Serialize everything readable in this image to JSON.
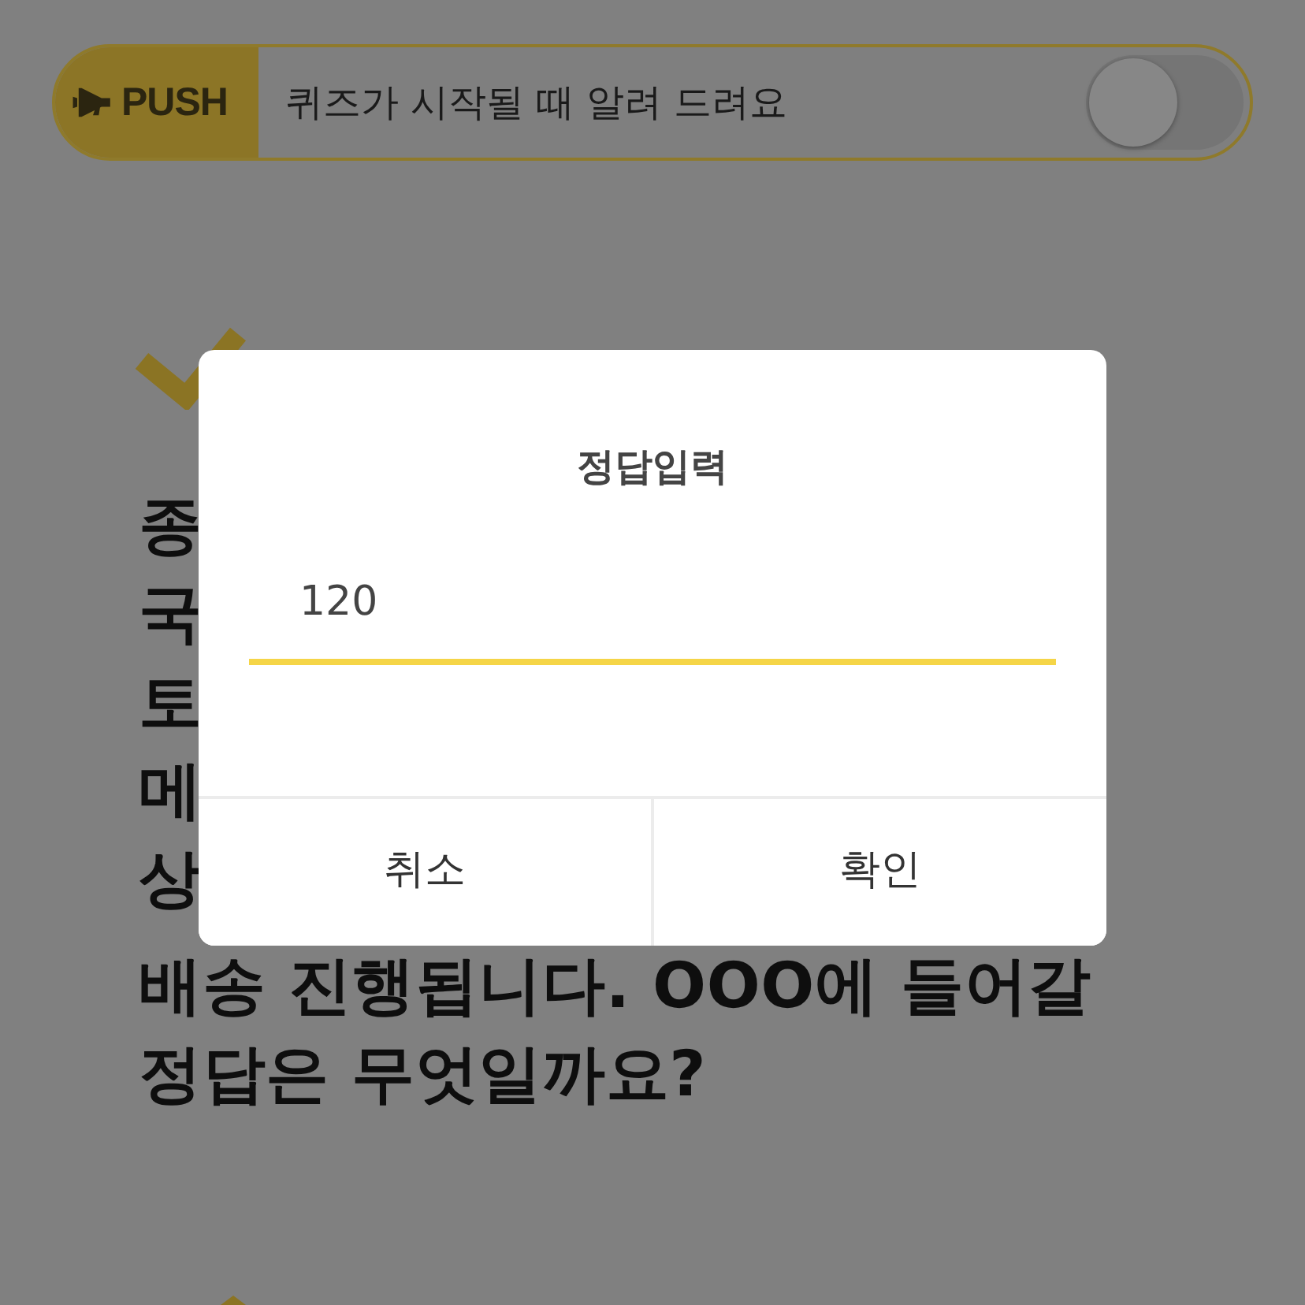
{
  "push": {
    "badge": "PUSH",
    "label": "퀴즈가 시작될 때 알려 드려요",
    "on": false
  },
  "question": {
    "lines": [
      "종",
      "국",
      "토",
      "메",
      "상",
      "배송 진행됩니다. OOO에 들어갈",
      "정답은 무엇일까요?"
    ]
  },
  "dialog": {
    "title": "정답입력",
    "answer": {
      "value": "120"
    },
    "buttons": [
      "취소",
      "확인"
    ]
  }
}
